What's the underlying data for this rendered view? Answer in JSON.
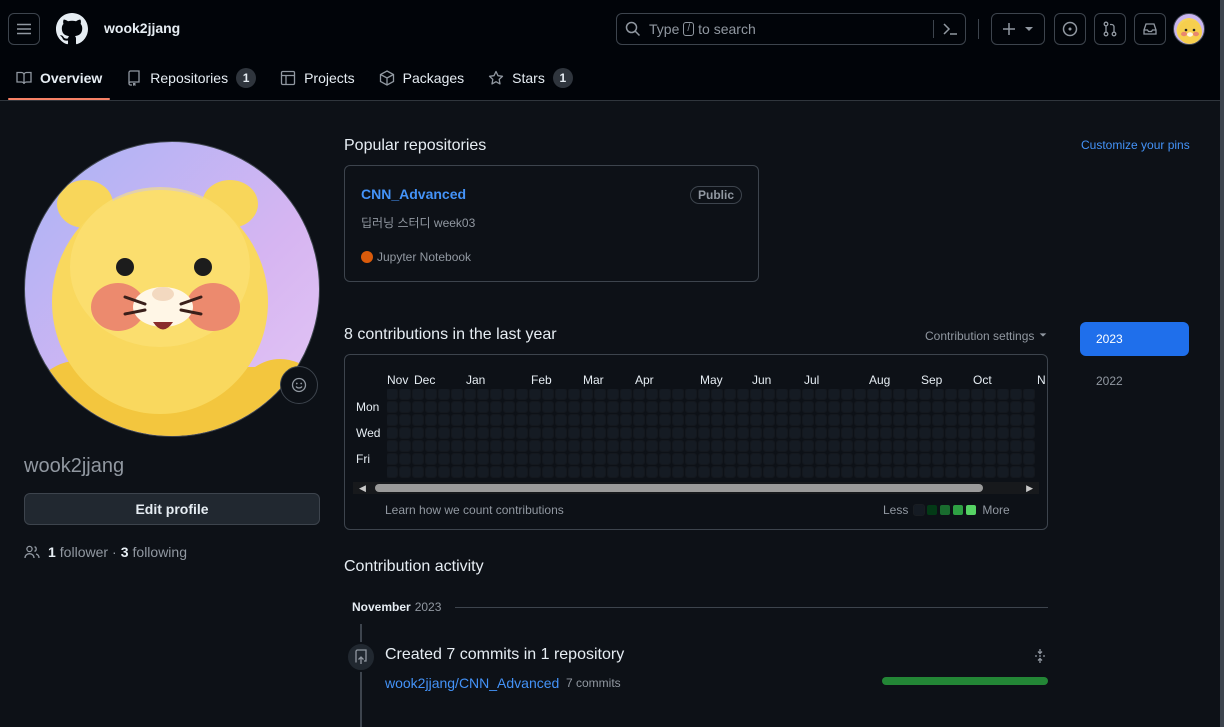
{
  "header": {
    "username": "wook2jjang",
    "search": {
      "prefix": "Type",
      "key": "/",
      "suffix": "to search"
    }
  },
  "tabs": [
    {
      "label": "Overview",
      "icon": "book-icon",
      "active": true
    },
    {
      "label": "Repositories",
      "icon": "repo-icon",
      "count": "1"
    },
    {
      "label": "Projects",
      "icon": "table-icon"
    },
    {
      "label": "Packages",
      "icon": "package-icon"
    },
    {
      "label": "Stars",
      "icon": "star-icon",
      "count": "1"
    }
  ],
  "profile": {
    "name": "wook2jjang",
    "edit_label": "Edit profile",
    "followers": "1",
    "followers_label": "follower",
    "following": "3",
    "following_label": "following",
    "separator": "·"
  },
  "pinned": {
    "title": "Popular repositories",
    "customize": "Customize your pins",
    "repo": {
      "name": "CNN_Advanced",
      "visibility": "Public",
      "description": "딥러닝 스터디 week03",
      "language": "Jupyter Notebook",
      "language_color": "#DA5B0B"
    }
  },
  "contributions": {
    "title": "8 contributions in the last year",
    "settings": "Contribution settings",
    "months": [
      "Nov",
      "Dec",
      "Jan",
      "Feb",
      "Mar",
      "Apr",
      "May",
      "Jun",
      "Jul",
      "Aug",
      "Sep",
      "Oct",
      "N"
    ],
    "days": [
      "Mon",
      "Wed",
      "Fri"
    ],
    "learn": "Learn how we count contributions",
    "less": "Less",
    "more": "More",
    "legend_colors": [
      "#151b23",
      "#033a16",
      "#196c2e",
      "#2ea043",
      "#56d364"
    ]
  },
  "years": [
    {
      "label": "2023",
      "active": true
    },
    {
      "label": "2022",
      "active": false
    }
  ],
  "activity": {
    "title": "Contribution activity",
    "month": "November",
    "year": "2023",
    "event": "Created 7 commits in 1 repository",
    "repo": "wook2jjang/CNN_Advanced",
    "commits": "7 commits"
  }
}
